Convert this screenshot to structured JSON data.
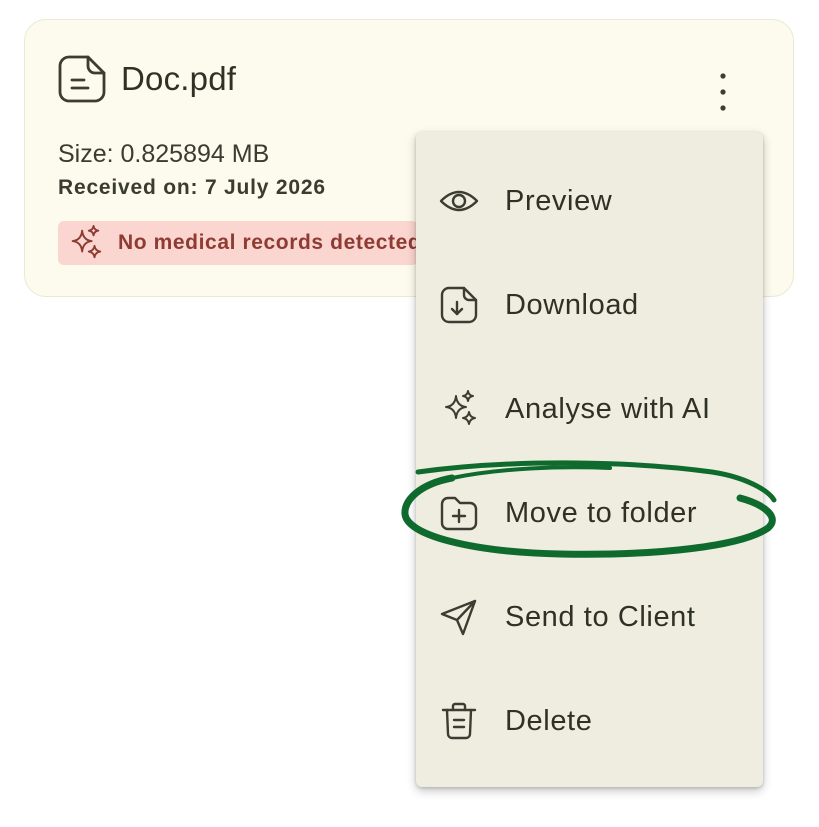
{
  "card": {
    "file_name": "Doc.pdf",
    "file_icon": "document-icon",
    "size": "Size: 0.825894 MB",
    "received": "Received on: 7 July 2026",
    "badge": {
      "icon": "sparkles-icon",
      "text": "No medical records detected"
    },
    "more_icon": "more-vertical-icon"
  },
  "menu": {
    "items": [
      {
        "label": "Preview",
        "icon": "eye-icon"
      },
      {
        "label": "Download",
        "icon": "download-icon"
      },
      {
        "label": "Analyse with AI",
        "icon": "sparkles-icon"
      },
      {
        "label": "Move to folder",
        "icon": "folder-plus-icon"
      },
      {
        "label": "Send to Client",
        "icon": "send-icon"
      },
      {
        "label": "Delete",
        "icon": "trash-icon"
      }
    ]
  },
  "colors": {
    "card_background": "#fcfbed",
    "menu_background": "#efede0",
    "badge_background": "#fbd5cf",
    "badge_text": "#8e3b33",
    "annotation_stroke": "#0f6b2d"
  }
}
